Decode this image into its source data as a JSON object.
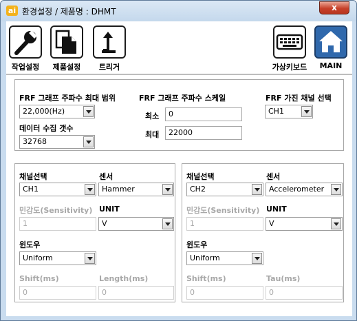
{
  "window": {
    "app_icon": "ai",
    "title": "환경설정 / 제품명 : DHMT",
    "close_glyph": "x"
  },
  "toolbar": {
    "work_settings": "작업설정",
    "product_settings": "제품설정",
    "trigger": "트리거",
    "virtual_keyboard": "가상키보드",
    "main": "MAIN"
  },
  "frf": {
    "max_range_label": "FRF 그래프 주파수 최대 범위",
    "max_range_value": "22,000(Hz)",
    "scale_label": "FRF 그래프 주파수 스케일",
    "min_label": "최소",
    "min_value": "0",
    "max_label": "최대",
    "max_value": "22000",
    "excite_channel_label": "FRF 가진 채널 선택",
    "excite_channel_value": "CH1",
    "acq_count_label": "데이터 수집 갯수",
    "acq_count_value": "32768"
  },
  "channels": [
    {
      "channel_label": "채널선택",
      "channel_value": "CH1",
      "sensor_label": "센서",
      "sensor_value": "Hammer",
      "sensitivity_label": "민감도(Sensitivity)",
      "sensitivity_value": "1",
      "unit_label": "UNIT",
      "unit_value": "V",
      "window_label": "윈도우",
      "window_value": "Uniform",
      "shift_label": "Shift(ms)",
      "shift_value": "0",
      "param_label": "Length(ms)",
      "param_value": "0"
    },
    {
      "channel_label": "채널선택",
      "channel_value": "CH2",
      "sensor_label": "센서",
      "sensor_value": "Accelerometer",
      "sensitivity_label": "민감도(Sensitivity)",
      "sensitivity_value": "1",
      "unit_label": "UNIT",
      "unit_value": "V",
      "window_label": "윈도우",
      "window_value": "Uniform",
      "shift_label": "Shift(ms)",
      "shift_value": "0",
      "param_label": "Tau(ms)",
      "param_value": "0"
    }
  ],
  "icons": {
    "work_settings": "wrench-icon",
    "product_settings": "documents-icon",
    "trigger": "arrow-up-icon",
    "virtual_keyboard": "keyboard-icon",
    "main": "home-icon"
  },
  "colors": {
    "window_frame": "#c9dcef",
    "close_button": "#c7402a",
    "main_button": "#2f68ac",
    "disabled_text": "#a8a8a8"
  }
}
